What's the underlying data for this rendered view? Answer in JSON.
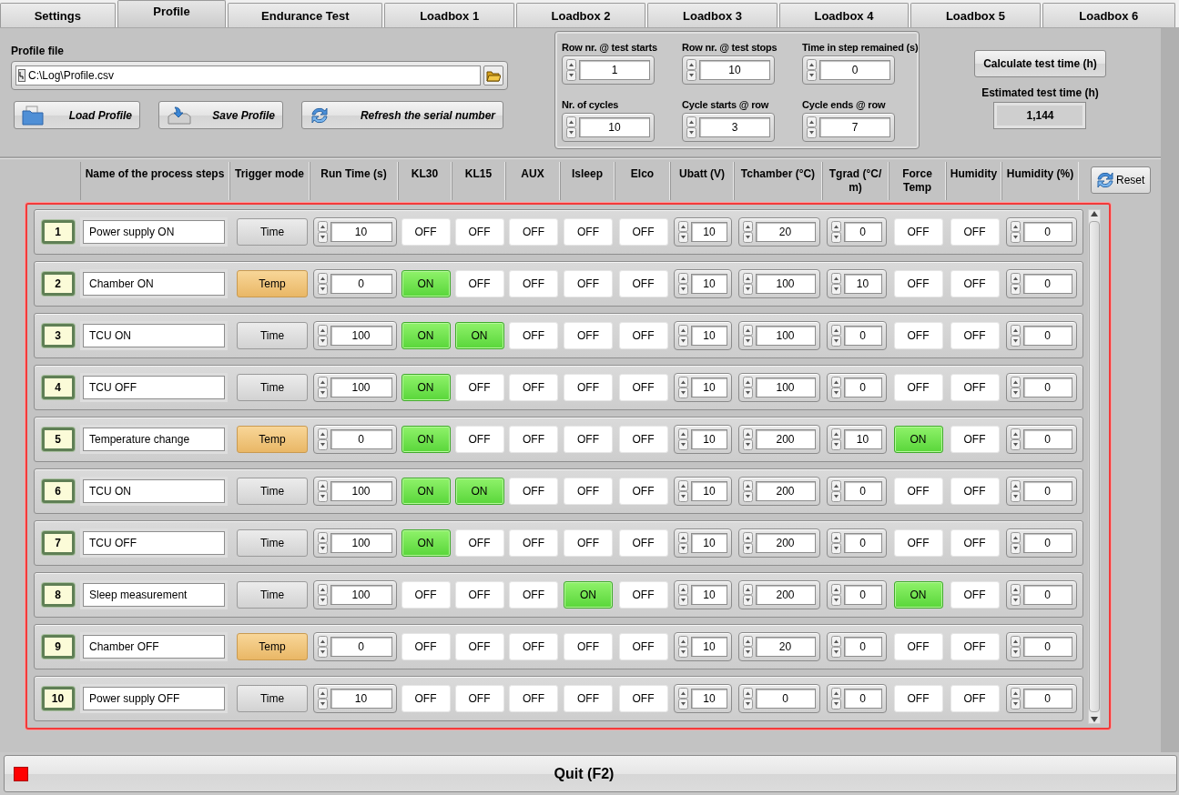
{
  "tabs": [
    {
      "label": "Settings",
      "selected": false
    },
    {
      "label": "Profile",
      "selected": true
    },
    {
      "label": "Endurance Test",
      "selected": false
    },
    {
      "label": "Loadbox 1",
      "selected": false
    },
    {
      "label": "Loadbox 2",
      "selected": false
    },
    {
      "label": "Loadbox 3",
      "selected": false
    },
    {
      "label": "Loadbox 4",
      "selected": false
    },
    {
      "label": "Loadbox 5",
      "selected": false
    },
    {
      "label": "Loadbox 6",
      "selected": false
    }
  ],
  "profile_file": {
    "label": "Profile file",
    "value": "C:\\Log\\Profile.csv"
  },
  "actions": [
    {
      "label": "Load Profile",
      "kind": "load"
    },
    {
      "label": "Save Profile",
      "kind": "save"
    },
    {
      "label": "Refresh the serial number",
      "kind": "refresh"
    }
  ],
  "settings": [
    {
      "label": "Row nr. @ test starts",
      "value": "1"
    },
    {
      "label": "Row nr. @ test stops",
      "value": "10"
    },
    {
      "label": "Time in step remained (s)",
      "value": "0"
    },
    {
      "label": "Nr. of cycles",
      "value": "10"
    },
    {
      "label": "Cycle starts @ row",
      "value": "3"
    },
    {
      "label": "Cycle ends @ row",
      "value": "7"
    }
  ],
  "calculate_button": "Calculate test time (h)",
  "estimated_time": {
    "label": "Estimated test time (h)",
    "value": "1,144"
  },
  "columns": [
    "Name of the process steps",
    "Trigger mode",
    "Run Time (s)",
    "KL30",
    "KL15",
    "AUX",
    "Isleep",
    "Elco",
    "Ubatt (V)",
    "Tchamber (°C)",
    "Tgrad (°C/ m)",
    "Force Temp",
    "Humidity",
    "Humidity (%)"
  ],
  "reset_button": "Reset",
  "rows": [
    {
      "step": "1",
      "name": "Power supply ON",
      "cells": [
        {
          "kind": "trigger",
          "label": "Time",
          "highlighted": false
        },
        {
          "kind": "number",
          "value": "10"
        },
        {
          "kind": "toggle",
          "label": "OFF",
          "on": false
        },
        {
          "kind": "toggle",
          "label": "OFF",
          "on": false
        },
        {
          "kind": "toggle",
          "label": "OFF",
          "on": false
        },
        {
          "kind": "toggle",
          "label": "OFF",
          "on": false
        },
        {
          "kind": "toggle",
          "label": "OFF",
          "on": false
        },
        {
          "kind": "number",
          "value": "10"
        },
        {
          "kind": "number",
          "value": "20"
        },
        {
          "kind": "number",
          "value": "0"
        },
        {
          "kind": "toggle",
          "label": "OFF",
          "on": false
        },
        {
          "kind": "toggle",
          "label": "OFF",
          "on": false
        },
        {
          "kind": "number",
          "value": "0"
        }
      ]
    },
    {
      "step": "2",
      "name": "Chamber ON",
      "cells": [
        {
          "kind": "trigger",
          "label": "Temp",
          "highlighted": true
        },
        {
          "kind": "number",
          "value": "0"
        },
        {
          "kind": "toggle",
          "label": "ON",
          "on": true
        },
        {
          "kind": "toggle",
          "label": "OFF",
          "on": false
        },
        {
          "kind": "toggle",
          "label": "OFF",
          "on": false
        },
        {
          "kind": "toggle",
          "label": "OFF",
          "on": false
        },
        {
          "kind": "toggle",
          "label": "OFF",
          "on": false
        },
        {
          "kind": "number",
          "value": "10"
        },
        {
          "kind": "number",
          "value": "100"
        },
        {
          "kind": "number",
          "value": "10"
        },
        {
          "kind": "toggle",
          "label": "OFF",
          "on": false
        },
        {
          "kind": "toggle",
          "label": "OFF",
          "on": false
        },
        {
          "kind": "number",
          "value": "0"
        }
      ]
    },
    {
      "step": "3",
      "name": "TCU ON",
      "cells": [
        {
          "kind": "trigger",
          "label": "Time",
          "highlighted": false
        },
        {
          "kind": "number",
          "value": "100"
        },
        {
          "kind": "toggle",
          "label": "ON",
          "on": true
        },
        {
          "kind": "toggle",
          "label": "ON",
          "on": true
        },
        {
          "kind": "toggle",
          "label": "OFF",
          "on": false
        },
        {
          "kind": "toggle",
          "label": "OFF",
          "on": false
        },
        {
          "kind": "toggle",
          "label": "OFF",
          "on": false
        },
        {
          "kind": "number",
          "value": "10"
        },
        {
          "kind": "number",
          "value": "100"
        },
        {
          "kind": "number",
          "value": "0"
        },
        {
          "kind": "toggle",
          "label": "OFF",
          "on": false
        },
        {
          "kind": "toggle",
          "label": "OFF",
          "on": false
        },
        {
          "kind": "number",
          "value": "0"
        }
      ]
    },
    {
      "step": "4",
      "name": "TCU OFF",
      "cells": [
        {
          "kind": "trigger",
          "label": "Time",
          "highlighted": false
        },
        {
          "kind": "number",
          "value": "100"
        },
        {
          "kind": "toggle",
          "label": "ON",
          "on": true
        },
        {
          "kind": "toggle",
          "label": "OFF",
          "on": false
        },
        {
          "kind": "toggle",
          "label": "OFF",
          "on": false
        },
        {
          "kind": "toggle",
          "label": "OFF",
          "on": false
        },
        {
          "kind": "toggle",
          "label": "OFF",
          "on": false
        },
        {
          "kind": "number",
          "value": "10"
        },
        {
          "kind": "number",
          "value": "100"
        },
        {
          "kind": "number",
          "value": "0"
        },
        {
          "kind": "toggle",
          "label": "OFF",
          "on": false
        },
        {
          "kind": "toggle",
          "label": "OFF",
          "on": false
        },
        {
          "kind": "number",
          "value": "0"
        }
      ]
    },
    {
      "step": "5",
      "name": "Temperature change",
      "cells": [
        {
          "kind": "trigger",
          "label": "Temp",
          "highlighted": true
        },
        {
          "kind": "number",
          "value": "0"
        },
        {
          "kind": "toggle",
          "label": "ON",
          "on": true
        },
        {
          "kind": "toggle",
          "label": "OFF",
          "on": false
        },
        {
          "kind": "toggle",
          "label": "OFF",
          "on": false
        },
        {
          "kind": "toggle",
          "label": "OFF",
          "on": false
        },
        {
          "kind": "toggle",
          "label": "OFF",
          "on": false
        },
        {
          "kind": "number",
          "value": "10"
        },
        {
          "kind": "number",
          "value": "200"
        },
        {
          "kind": "number",
          "value": "10"
        },
        {
          "kind": "toggle",
          "label": "ON",
          "on": true
        },
        {
          "kind": "toggle",
          "label": "OFF",
          "on": false
        },
        {
          "kind": "number",
          "value": "0"
        }
      ]
    },
    {
      "step": "6",
      "name": "TCU ON",
      "cells": [
        {
          "kind": "trigger",
          "label": "Time",
          "highlighted": false
        },
        {
          "kind": "number",
          "value": "100"
        },
        {
          "kind": "toggle",
          "label": "ON",
          "on": true
        },
        {
          "kind": "toggle",
          "label": "ON",
          "on": true
        },
        {
          "kind": "toggle",
          "label": "OFF",
          "on": false
        },
        {
          "kind": "toggle",
          "label": "OFF",
          "on": false
        },
        {
          "kind": "toggle",
          "label": "OFF",
          "on": false
        },
        {
          "kind": "number",
          "value": "10"
        },
        {
          "kind": "number",
          "value": "200"
        },
        {
          "kind": "number",
          "value": "0"
        },
        {
          "kind": "toggle",
          "label": "OFF",
          "on": false
        },
        {
          "kind": "toggle",
          "label": "OFF",
          "on": false
        },
        {
          "kind": "number",
          "value": "0"
        }
      ]
    },
    {
      "step": "7",
      "name": "TCU OFF",
      "cells": [
        {
          "kind": "trigger",
          "label": "Time",
          "highlighted": false
        },
        {
          "kind": "number",
          "value": "100"
        },
        {
          "kind": "toggle",
          "label": "ON",
          "on": true
        },
        {
          "kind": "toggle",
          "label": "OFF",
          "on": false
        },
        {
          "kind": "toggle",
          "label": "OFF",
          "on": false
        },
        {
          "kind": "toggle",
          "label": "OFF",
          "on": false
        },
        {
          "kind": "toggle",
          "label": "OFF",
          "on": false
        },
        {
          "kind": "number",
          "value": "10"
        },
        {
          "kind": "number",
          "value": "200"
        },
        {
          "kind": "number",
          "value": "0"
        },
        {
          "kind": "toggle",
          "label": "OFF",
          "on": false
        },
        {
          "kind": "toggle",
          "label": "OFF",
          "on": false
        },
        {
          "kind": "number",
          "value": "0"
        }
      ]
    },
    {
      "step": "8",
      "name": "Sleep measurement",
      "cells": [
        {
          "kind": "trigger",
          "label": "Time",
          "highlighted": false
        },
        {
          "kind": "number",
          "value": "100"
        },
        {
          "kind": "toggle",
          "label": "OFF",
          "on": false
        },
        {
          "kind": "toggle",
          "label": "OFF",
          "on": false
        },
        {
          "kind": "toggle",
          "label": "OFF",
          "on": false
        },
        {
          "kind": "toggle",
          "label": "ON",
          "on": true
        },
        {
          "kind": "toggle",
          "label": "OFF",
          "on": false
        },
        {
          "kind": "number",
          "value": "10"
        },
        {
          "kind": "number",
          "value": "200"
        },
        {
          "kind": "number",
          "value": "0"
        },
        {
          "kind": "toggle",
          "label": "ON",
          "on": true
        },
        {
          "kind": "toggle",
          "label": "OFF",
          "on": false
        },
        {
          "kind": "number",
          "value": "0"
        }
      ]
    },
    {
      "step": "9",
      "name": "Chamber OFF",
      "cells": [
        {
          "kind": "trigger",
          "label": "Temp",
          "highlighted": true
        },
        {
          "kind": "number",
          "value": "0"
        },
        {
          "kind": "toggle",
          "label": "OFF",
          "on": false
        },
        {
          "kind": "toggle",
          "label": "OFF",
          "on": false
        },
        {
          "kind": "toggle",
          "label": "OFF",
          "on": false
        },
        {
          "kind": "toggle",
          "label": "OFF",
          "on": false
        },
        {
          "kind": "toggle",
          "label": "OFF",
          "on": false
        },
        {
          "kind": "number",
          "value": "10"
        },
        {
          "kind": "number",
          "value": "20"
        },
        {
          "kind": "number",
          "value": "0"
        },
        {
          "kind": "toggle",
          "label": "OFF",
          "on": false
        },
        {
          "kind": "toggle",
          "label": "OFF",
          "on": false
        },
        {
          "kind": "number",
          "value": "0"
        }
      ]
    },
    {
      "step": "10",
      "name": "Power supply OFF",
      "cells": [
        {
          "kind": "trigger",
          "label": "Time",
          "highlighted": false
        },
        {
          "kind": "number",
          "value": "10"
        },
        {
          "kind": "toggle",
          "label": "OFF",
          "on": false
        },
        {
          "kind": "toggle",
          "label": "OFF",
          "on": false
        },
        {
          "kind": "toggle",
          "label": "OFF",
          "on": false
        },
        {
          "kind": "toggle",
          "label": "OFF",
          "on": false
        },
        {
          "kind": "toggle",
          "label": "OFF",
          "on": false
        },
        {
          "kind": "number",
          "value": "10"
        },
        {
          "kind": "number",
          "value": "0"
        },
        {
          "kind": "number",
          "value": "0"
        },
        {
          "kind": "toggle",
          "label": "OFF",
          "on": false
        },
        {
          "kind": "toggle",
          "label": "OFF",
          "on": false
        },
        {
          "kind": "number",
          "value": "0"
        }
      ]
    }
  ],
  "quit_button": "Quit (F2)"
}
